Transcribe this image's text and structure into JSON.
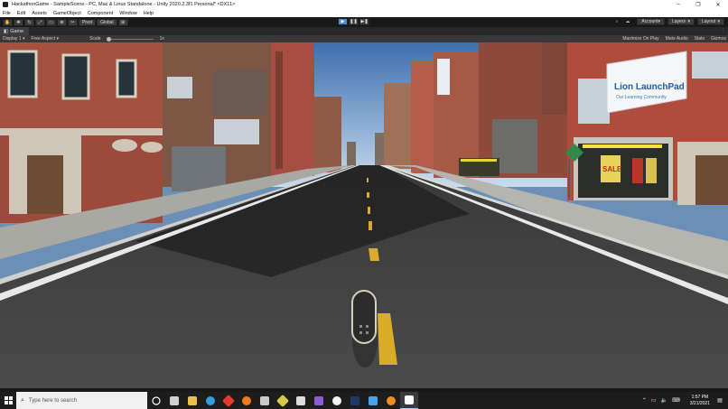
{
  "window": {
    "title": "HackathonGame - SampleScene - PC, Mac & Linux Standalone - Unity 2020.2.3f1 Personal* <DX11>",
    "minimize": "–",
    "maximize": "❐",
    "close": "✕"
  },
  "menu": [
    "File",
    "Edit",
    "Assets",
    "GameObject",
    "Component",
    "Window",
    "Help"
  ],
  "toolbar": {
    "pivot_label": "Pivot",
    "global_label": "Global",
    "account_label": "Account",
    "layers_label": "Layers",
    "layout_label": "Layout"
  },
  "game_tab": {
    "label": "Game",
    "display": "Display 1",
    "aspect": "Free Aspect",
    "scale_label": "Scale",
    "scale_value": "1x",
    "maximize_on_play": "Maximize On Play",
    "mute_audio": "Mute Audio",
    "stats": "Stats",
    "gizmos": "Gizmos"
  },
  "scene": {
    "billboard_title": "Lion LaunchPad",
    "billboard_subtitle": "Our Learning Community",
    "shop_sign": "SALE"
  },
  "taskbar": {
    "search_placeholder": "Type here to search",
    "time": "1:57 PM",
    "date": "3/21/2021",
    "icons": [
      {
        "name": "task-view-icon",
        "color": "#d0d0d0"
      },
      {
        "name": "explorer-icon",
        "color": "#e8c04a"
      },
      {
        "name": "edge-icon",
        "color": "#2f9fe0"
      },
      {
        "name": "red-app-icon",
        "color": "#e23b2e"
      },
      {
        "name": "firefox-icon",
        "color": "#f07a1c"
      },
      {
        "name": "notepad-icon",
        "color": "#c9c9c9"
      },
      {
        "name": "yellow-app-icon",
        "color": "#d8c84a"
      },
      {
        "name": "unity-hub-icon",
        "color": "#dddddd"
      },
      {
        "name": "visual-studio-icon",
        "color": "#8b5cd6"
      },
      {
        "name": "unity-icon",
        "color": "#f2f2f2"
      },
      {
        "name": "photoshop-icon",
        "color": "#1e3a6b"
      },
      {
        "name": "photos-icon",
        "color": "#4aa3e6"
      },
      {
        "name": "blender-icon",
        "color": "#f08a24"
      },
      {
        "name": "unity-editor-icon",
        "color": "#ffffff"
      }
    ]
  }
}
